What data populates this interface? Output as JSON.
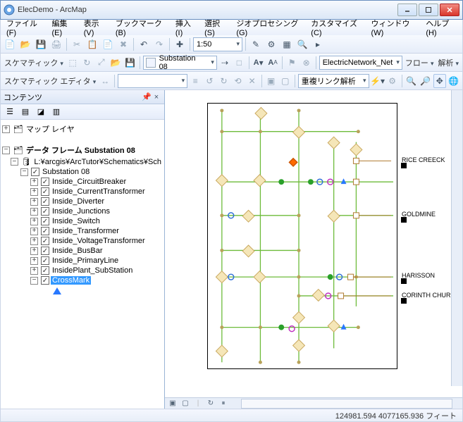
{
  "window": {
    "title": "ElecDemo - ArcMap"
  },
  "menus": [
    "ファイル(F)",
    "編集(E)",
    "表示(V)",
    "ブックマーク(B)",
    "挿入(I)",
    "選択(S)",
    "ジオプロセシング(G)",
    "カスタマイズ(C)",
    "ウィンドウ(W)",
    "ヘルプ(H)"
  ],
  "toolbar1": {
    "layer_combo": "Substation 08",
    "scale_combo": "1:50",
    "network_combo": "ElectricNetwork_Net",
    "flow_label": "フロー",
    "analysis_label": "解析"
  },
  "toolbar2": {
    "schematic_label": "スケマティック",
    "editor_label": "スケマティック エディタ",
    "link_combo": "重複リンク解析"
  },
  "toc": {
    "title": "コンテンツ",
    "root": "マップ レイヤ",
    "frame": "データ フレーム Substation 08",
    "gdb": "L:¥arcgis¥ArcTutor¥Schematics¥Sch",
    "group": "Substation 08",
    "layers": [
      "Inside_CircuitBreaker",
      "Inside_CurrentTransformer",
      "Inside_Diverter",
      "Inside_Junctions",
      "Inside_Switch",
      "Inside_Transformer",
      "Inside_VoltageTransformer",
      "Inside_BusBar",
      "Inside_PrimaryLine",
      "InsidePlant_SubStation",
      "CrossMark"
    ],
    "selected_index": 10
  },
  "map_labels": [
    "RICE CREECK",
    "GOLDMINE",
    "HARISSON",
    "CORINTH CHURCH"
  ],
  "status": "124981.594  4077165.936 フィート"
}
